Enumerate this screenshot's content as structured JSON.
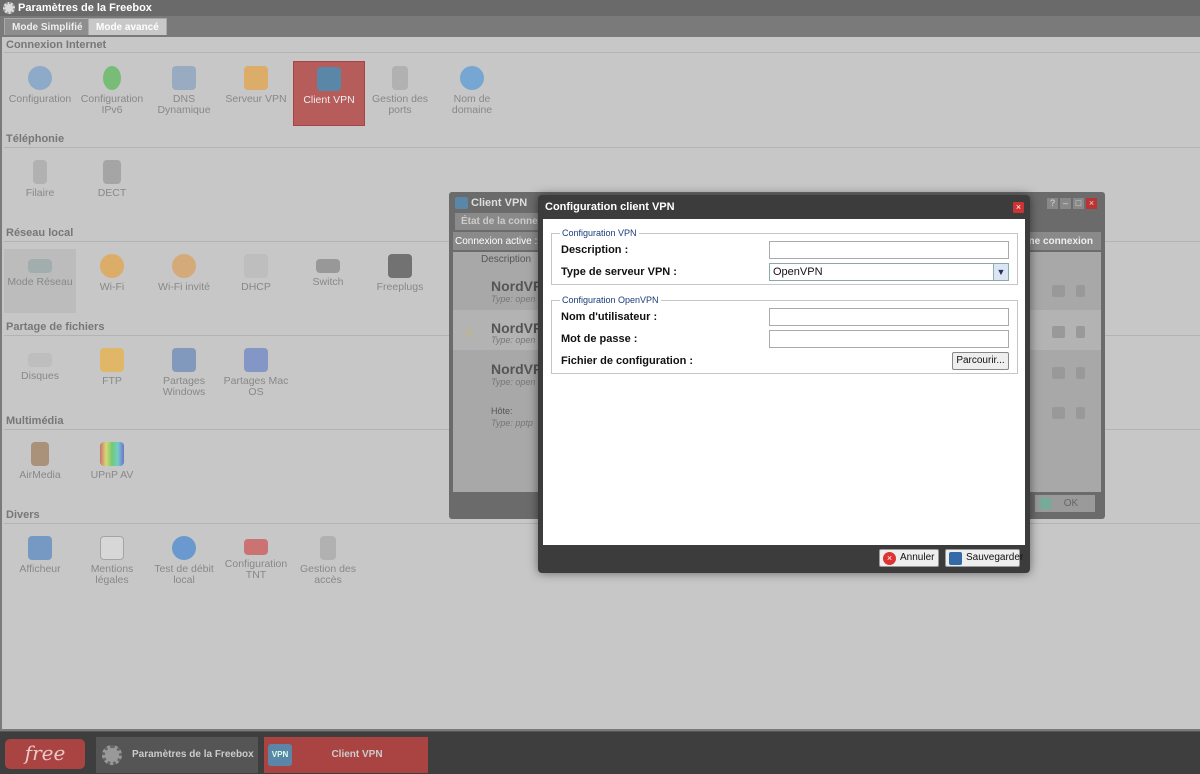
{
  "app": {
    "title": "Paramètres de la Freebox"
  },
  "mode_tabs": [
    {
      "label": "Mode Simplifié"
    },
    {
      "label": "Mode avancé"
    }
  ],
  "sections": [
    {
      "title": "Connexion Internet",
      "items": [
        {
          "label": "Configuration",
          "icon": "gears-icon"
        },
        {
          "label": "Configuration IPv6",
          "icon": "lock-6-icon"
        },
        {
          "label": "DNS Dynamique",
          "icon": "network-icon"
        },
        {
          "label": "Serveur VPN",
          "icon": "vpn-server-icon"
        },
        {
          "label": "Client VPN",
          "icon": "vpn-client-icon"
        },
        {
          "label": "Gestion des ports",
          "icon": "port-plug-icon"
        },
        {
          "label": "Nom de domaine",
          "icon": "globe-icon"
        }
      ]
    },
    {
      "title": "Téléphonie",
      "items": [
        {
          "label": "Filaire",
          "icon": "phone-icon"
        },
        {
          "label": "DECT",
          "icon": "dect-phone-icon"
        }
      ]
    },
    {
      "title": "Réseau local",
      "items": [
        {
          "label": "Mode Réseau",
          "icon": "router-icon"
        },
        {
          "label": "Wi-Fi",
          "icon": "wifi-antenna-icon"
        },
        {
          "label": "Wi-Fi invité",
          "icon": "wifi-guest-icon"
        },
        {
          "label": "DHCP",
          "icon": "dhcp-icon"
        },
        {
          "label": "Switch",
          "icon": "switch-icon"
        },
        {
          "label": "Freeplugs",
          "icon": "freeplug-icon"
        }
      ]
    },
    {
      "title": "Partage de fichiers",
      "items": [
        {
          "label": "Disques",
          "icon": "disk-icon"
        },
        {
          "label": "FTP",
          "icon": "ftp-folder-icon"
        },
        {
          "label": "Partages Windows",
          "icon": "windows-share-icon"
        },
        {
          "label": "Partages Mac OS",
          "icon": "mac-share-icon"
        }
      ]
    },
    {
      "title": "Multimédia",
      "items": [
        {
          "label": "AirMedia",
          "icon": "speaker-icon"
        },
        {
          "label": "UPnP AV",
          "icon": "tv-icon"
        }
      ]
    },
    {
      "title": "Divers",
      "items": [
        {
          "label": "Afficheur",
          "icon": "display-icon"
        },
        {
          "label": "Mentions légales",
          "icon": "linux-doc-icon"
        },
        {
          "label": "Test de débit local",
          "icon": "speed-globe-icon"
        },
        {
          "label": "Configuration TNT",
          "icon": "tnt-icon"
        },
        {
          "label": "Gestion des accès",
          "icon": "padlock-icon"
        }
      ]
    }
  ],
  "client_vpn_window": {
    "title": "Client VPN",
    "tab": "État de la connex",
    "active_label": "Connexion active :",
    "new_connection": "une connexion",
    "column_header": "Description",
    "rows": [
      {
        "name": "NordVP",
        "type": "Type: open"
      },
      {
        "name": "NordVP",
        "type": "Type: open"
      },
      {
        "name": "NordVP",
        "type": "Type: open"
      },
      {
        "name": "Hôte:",
        "type": "Type: pptp"
      }
    ],
    "ok_label": "OK"
  },
  "dialog": {
    "title": "Configuration client VPN",
    "fieldset_vpn": {
      "legend": "Configuration VPN",
      "description_label": "Description :",
      "description_value": "",
      "server_type_label": "Type de serveur VPN :",
      "server_type_value": "OpenVPN"
    },
    "fieldset_openvpn": {
      "legend": "Configuration OpenVPN",
      "username_label": "Nom d'utilisateur :",
      "username_value": "",
      "password_label": "Mot de passe :",
      "password_value": "",
      "config_file_label": "Fichier de configuration :",
      "browse_label": "Parcourir..."
    },
    "cancel_label": "Annuler",
    "save_label": "Sauvegarder"
  },
  "taskbar": {
    "logo": "free",
    "task1": "Paramètres de la Freebox",
    "task2_icon": "VPN",
    "task2": "Client VPN"
  },
  "colors": {
    "selected": "#b65c5b",
    "accent_blue": "#1b3b7a",
    "dialog_frame": "#3c3c3c"
  }
}
